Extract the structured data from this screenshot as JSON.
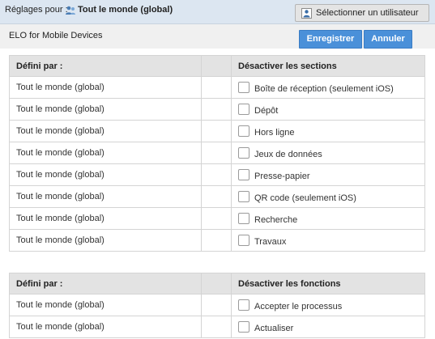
{
  "header": {
    "label": "Réglages pour :",
    "scope": "Tout le monde (global)",
    "select_user_label": "Sélectionner un utilisateur"
  },
  "subheader": {
    "title": "ELO for Mobile Devices",
    "save_label": "Enregistrer",
    "cancel_label": "Annuler"
  },
  "sections_table": {
    "col_defined_by": "Défini par :",
    "col_disable": "Désactiver les sections",
    "rows": [
      {
        "defined_by": "Tout le monde (global)",
        "label": "Boîte de réception (seulement iOS)",
        "checked": false
      },
      {
        "defined_by": "Tout le monde (global)",
        "label": "Dépôt",
        "checked": false
      },
      {
        "defined_by": "Tout le monde (global)",
        "label": "Hors ligne",
        "checked": false
      },
      {
        "defined_by": "Tout le monde (global)",
        "label": "Jeux de données",
        "checked": false
      },
      {
        "defined_by": "Tout le monde (global)",
        "label": "Presse-papier",
        "checked": false
      },
      {
        "defined_by": "Tout le monde (global)",
        "label": "QR code (seulement iOS)",
        "checked": false
      },
      {
        "defined_by": "Tout le monde (global)",
        "label": "Recherche",
        "checked": false
      },
      {
        "defined_by": "Tout le monde (global)",
        "label": "Travaux",
        "checked": false
      }
    ]
  },
  "functions_table": {
    "col_defined_by": "Défini par :",
    "col_disable": "Désactiver les fonctions",
    "rows": [
      {
        "defined_by": "Tout le monde (global)",
        "label": "Accepter le processus",
        "checked": false
      },
      {
        "defined_by": "Tout le monde (global)",
        "label": "Actualiser",
        "checked": false
      }
    ]
  },
  "colors": {
    "accent": "#4a90d9",
    "header_bg": "#dce6f1",
    "table_header_bg": "#e3e3e3"
  }
}
